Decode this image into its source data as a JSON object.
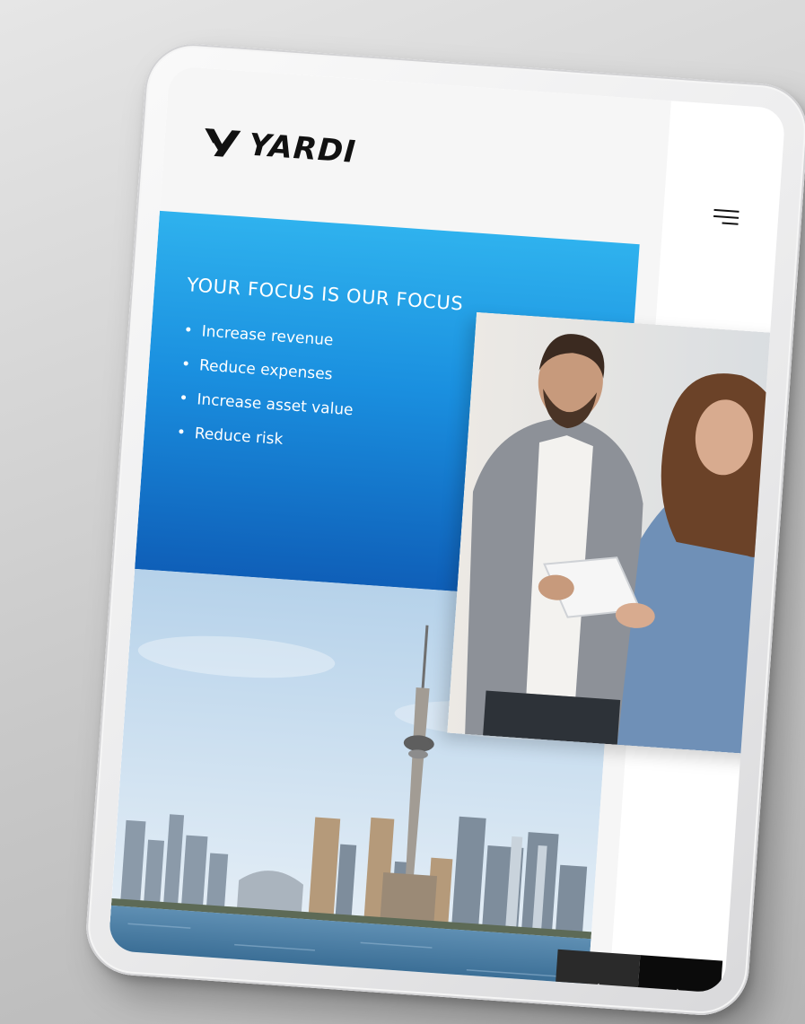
{
  "brand": {
    "name": "YARDI",
    "accent": "#1e9be6",
    "accent_dark": "#0f5fb8"
  },
  "header": {
    "menu_icon": "hamburger-menu-icon"
  },
  "hero": {
    "title": "YOUR FOCUS IS OUR FOCUS",
    "bullets": [
      "Increase revenue",
      "Reduce expenses",
      "Increase asset value",
      "Reduce risk"
    ]
  },
  "carousel": {
    "prev_icon": "chevron-left-icon",
    "next_icon": "chevron-right-icon",
    "prev_label": "‹",
    "next_label": "›"
  }
}
